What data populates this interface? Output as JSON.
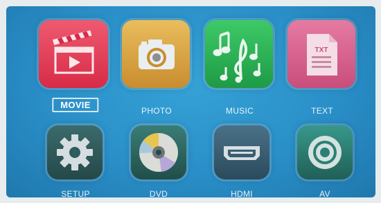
{
  "menu": {
    "items": [
      {
        "label": "MOVIE",
        "icon": "movie-clapper-icon",
        "color": "#e43a55",
        "selected": true
      },
      {
        "label": "PHOTO",
        "icon": "camera-icon",
        "color": "#d9a544"
      },
      {
        "label": "MUSIC",
        "icon": "music-notes-icon",
        "color": "#2bb154"
      },
      {
        "label": "TEXT",
        "icon": "text-document-icon",
        "color": "#d8638f"
      },
      {
        "label": "SETUP",
        "icon": "gear-icon",
        "color": "#2f5c5c"
      },
      {
        "label": "DVD",
        "icon": "disc-icon",
        "color": "#2f6a63"
      },
      {
        "label": "HDMI",
        "icon": "hdmi-port-icon",
        "color": "#3a5e72"
      },
      {
        "label": "AV",
        "icon": "av-circle-icon",
        "color": "#2c7f74"
      }
    ]
  },
  "text_icon_badge": "TXT"
}
